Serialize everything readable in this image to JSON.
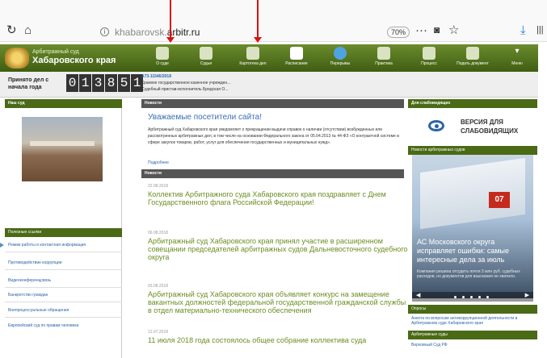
{
  "browser": {
    "url_host": "khabarovsk.",
    "url_rest": "arbitr.ru",
    "zoom": "70%"
  },
  "header": {
    "court_small": "Арбитражный суд",
    "court_large": "Хабаровского края",
    "nav": [
      {
        "label": "О суде"
      },
      {
        "label": "Судьи"
      },
      {
        "label": "Картотека дел"
      },
      {
        "label": "Расписание"
      },
      {
        "label": "Перерывы"
      },
      {
        "label": "Практика"
      },
      {
        "label": "Процесс"
      },
      {
        "label": "Подать документ"
      },
      {
        "label": "Меню"
      }
    ]
  },
  "subheader": {
    "today_label_1": "Принято дел с",
    "today_label_2": "начала года",
    "counter": [
      "0",
      "1",
      "3",
      "8",
      "5",
      "1"
    ],
    "case_id": "А73-11546/2018",
    "case_line_1": "Краевое государственное казенное учрежден...",
    "case_line_2": "Судебный пристав-исполнитель Бредская О..."
  },
  "left": {
    "title": "Наш суд",
    "links_title": "Полезные ссылки",
    "links": [
      "Режим работы и контактная информация",
      "Противодействие коррупции",
      "Видеоконференцсвязь",
      "Банкротство граждан",
      "Внепроцессуальные обращения",
      "Европейский суд по правам человека"
    ]
  },
  "center": {
    "notice_header": "Новости",
    "notice_title": "Уважаемые посетители сайта!",
    "notice_body": "Арбитражный суд Хабаровского края уведомляет о прекращении выдачи справок о наличии (отсутствии) возбужденных или рассмотренных арбитражных дел, в том числе на основании Федерального закона от 05.04.2013 № 44-ФЗ «О контрактной системе в сфере закупок товаров, работ, услуг для обеспечения государственных и муниципальных нужд».",
    "more": "Подробнее",
    "news_header": "Новости",
    "news": [
      {
        "date": "22.08.2018",
        "title": "Коллектив Арбитражного суда Хабаровского края поздравляет с Днем Государственного флага Российской Федерации!"
      },
      {
        "date": "06.08.2018",
        "title": "Арбитражный суд Хабаровского края принял участие в расширенном совещании председателей арбитражных судов Дальневосточного судебного округа"
      },
      {
        "date": "03.08.2018",
        "title": "Арбитражный суд Хабаровского края объявляет конкурс на замещение вакантных должностей федеральной государственной гражданской службы в отдел материально-технического обеспечения"
      },
      {
        "date": "12.07.2018",
        "title": "11 июля 2018 года состоялось общее собрание коллектива суда"
      }
    ]
  },
  "right": {
    "vision_header": "Для слабовидящих",
    "vision_line_1": "ВЕРСИЯ ДЛЯ",
    "vision_line_2": "СЛАБОВИДЯЩИХ",
    "slider_header": "Новости арбитражных судов",
    "slide_badge": "07",
    "slide_title": "АС Московского округа исправляет ошибки: самые интересные дела за июль",
    "slide_sub": "Компания решила отсудить почти 3 млн руб. судебных расходов, но документов для взыскания не хватило.",
    "polls_header": "Опросы",
    "poll_link": "Анкета по вопросам антикоррупционной деятельности в Арбитражном суде Хабаровского края",
    "courts_header": "Арбитражные суды",
    "courts_link": "Верховный Суд РФ"
  }
}
